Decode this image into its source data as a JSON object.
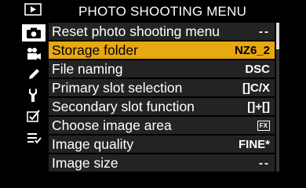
{
  "menu": {
    "title": "PHOTO SHOOTING MENU"
  },
  "sidebar": {
    "items": [
      {
        "icon": "playback-icon"
      },
      {
        "icon": "camera-icon",
        "active": true
      },
      {
        "icon": "movie-camera-icon"
      },
      {
        "icon": "pencil-icon"
      },
      {
        "icon": "wrench-icon"
      },
      {
        "icon": "retouch-icon"
      },
      {
        "icon": "my-menu-icon"
      }
    ]
  },
  "rows": [
    {
      "label": "Reset photo shooting menu",
      "value": "--"
    },
    {
      "label": "Storage folder",
      "value": "NZ6_2"
    },
    {
      "label": "File naming",
      "value": "DSC"
    },
    {
      "label": "Primary slot selection",
      "value": "[]C/X"
    },
    {
      "label": "Secondary slot function",
      "value": "[]+[]"
    },
    {
      "label": "Choose image area",
      "value": "FX"
    },
    {
      "label": "Image quality",
      "value": "FINE*"
    },
    {
      "label": "Image size",
      "value": "--"
    }
  ],
  "colors": {
    "selected_row": "#e8a812",
    "row_bg": "#232323",
    "background": "#000000"
  },
  "scroll": {
    "position_fraction": 0
  }
}
